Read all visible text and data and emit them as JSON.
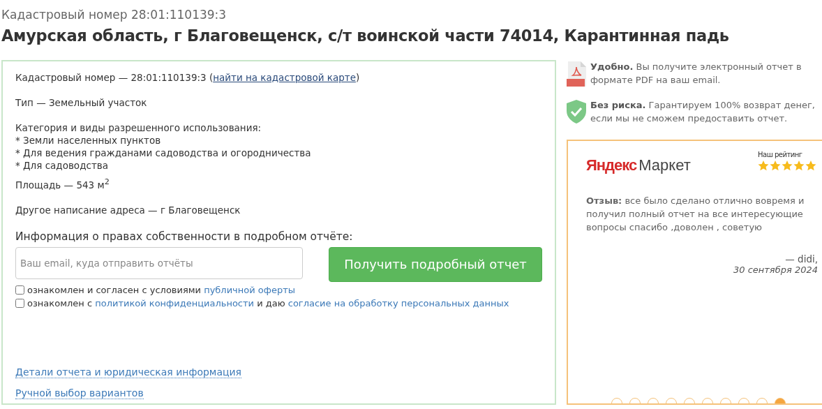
{
  "header": {
    "subtitle": "Кадастровый номер 28:01:110139:3",
    "title": "Амурская область, г Благовещенск, с/т воинской части 74014, Карантинная падь"
  },
  "details": {
    "cadastral": {
      "text": "Кадастровый номер — 28:01:110139:3 (",
      "link": "найти на кадастровой карте",
      "after": ")"
    },
    "type": "Тип — Земельный участок",
    "category": {
      "title": "Категория и виды разрешенного использования:",
      "items": [
        "* Земли населенных пунктов",
        "* Для ведения гражданами садоводства и огородничества",
        "* Для садоводства"
      ]
    },
    "area": "Площадь — 543 м$^{2}$",
    "alt_address": "Другое написание адреса — г Благовещенск"
  },
  "order": {
    "heading": "Информация о правах собственности в подробном отчёте:",
    "email_placeholder": "Ваш email, куда отправить отчёты",
    "button": "Получить подробный отчет",
    "agreements": [
      {
        "checked": false,
        "parts": [
          {
            "kind": "text",
            "text": "ознакомлен и согласен с условиями "
          },
          {
            "kind": "link",
            "text": "публичной оферты"
          }
        ]
      },
      {
        "checked": false,
        "parts": [
          {
            "kind": "text",
            "text": "ознакомлен с "
          },
          {
            "kind": "link",
            "text": "политикой конфиденциальности"
          },
          {
            "kind": "text",
            "text": " и даю "
          },
          {
            "kind": "link",
            "text": "согласие на обработку персональных данных"
          }
        ]
      }
    ]
  },
  "footer_links": [
    "Детали отчета и юридическая информация",
    "Ручной выбор вариантов"
  ],
  "benefits": [
    {
      "kind": "pdf",
      "title": "Удобно.",
      "text": "Вы получите электронный отчет в формате PDF на ваш email."
    },
    {
      "kind": "shield",
      "title": "Без риска.",
      "text": "Гарантируем 100% возврат денег, если мы не сможем предоставить отчет."
    }
  ],
  "review": {
    "logo": {
      "brand": "Яндекс",
      "product": "Маркет"
    },
    "rating_label": "Наш рейтинг",
    "stars": 5,
    "label": "Отзыв:",
    "text": "все было сделано отлично вовремя и получил полный отчет на все интересующие вопросы спасибо ,доволен , советую",
    "author": "— didi,",
    "date": "30 сентября 2024",
    "dots": [
      {
        "selected": false
      },
      {
        "selected": false
      },
      {
        "selected": false
      },
      {
        "selected": false
      },
      {
        "selected": false
      },
      {
        "selected": false
      },
      {
        "selected": false
      },
      {
        "selected": false
      },
      {
        "selected": false
      },
      {
        "selected": true
      }
    ]
  }
}
